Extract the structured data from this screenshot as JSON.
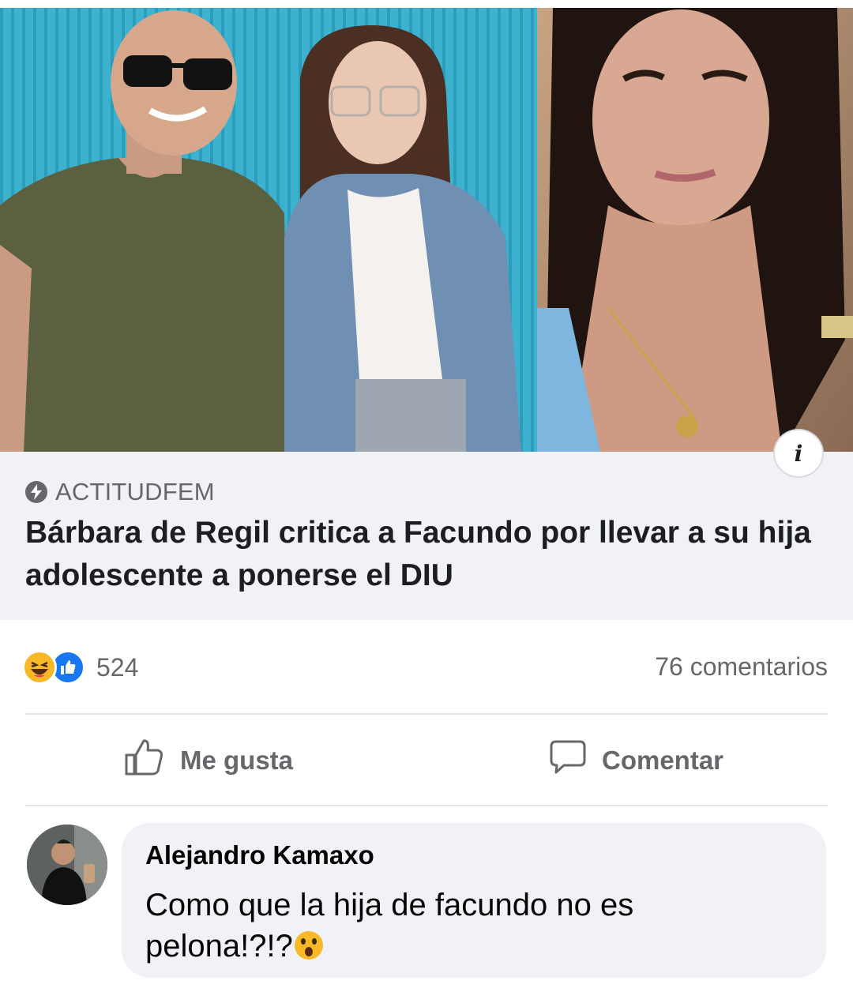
{
  "link_preview": {
    "source": "ACTITUDFEM",
    "headline": "Bárbara de Regil critica a Facundo por llevar a su hija adolescente a ponerse el DIU",
    "info_icon": "info-icon"
  },
  "engagement": {
    "reaction_icons": [
      "haha-icon",
      "like-icon"
    ],
    "reaction_count": "524",
    "comments_count": "76 comentarios"
  },
  "actions": {
    "like_label": "Me gusta",
    "like_icon": "thumbs-up-icon",
    "comment_label": "Comentar",
    "comment_icon": "speech-bubble-icon"
  },
  "comment": {
    "author": "Alejandro Kamaxo",
    "text": "Como que la hija de facundo no es pelona!?!?",
    "emoji": "astonished-face-emoji"
  },
  "colors": {
    "link_box_bg": "#f0f2f5",
    "muted_text": "#65676b",
    "like_blue": "#1877f2",
    "haha_yellow": "#f7b928",
    "hero_wall_blue": "#3fb3d0"
  }
}
